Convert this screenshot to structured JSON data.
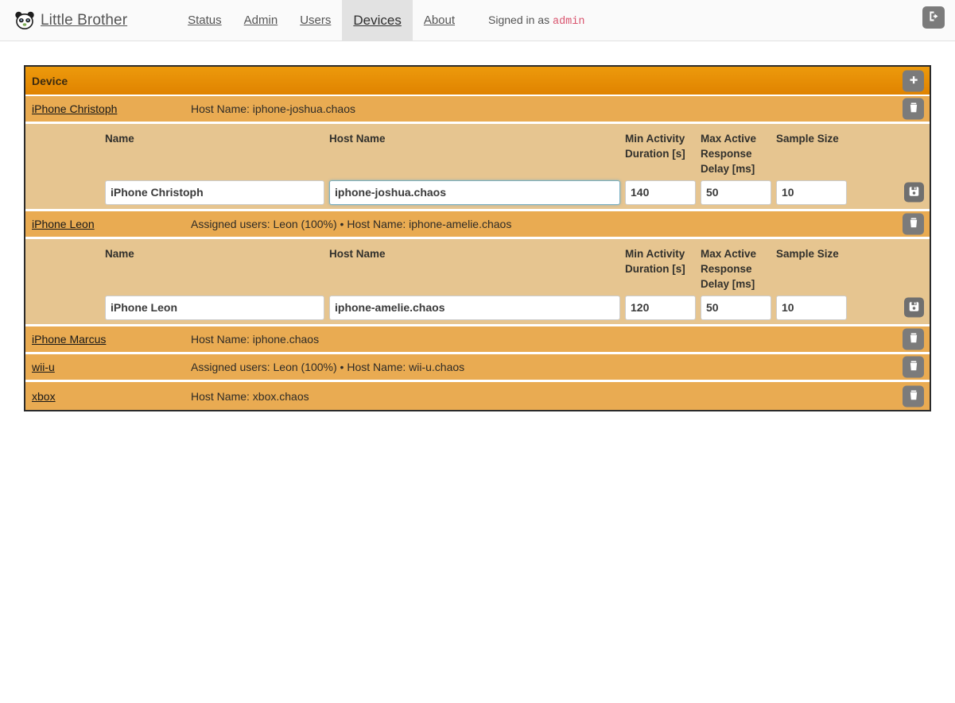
{
  "nav": {
    "brand": "Little Brother",
    "brand_icon": "panda-icon",
    "links": [
      {
        "label": "Status",
        "active": false
      },
      {
        "label": "Admin",
        "active": false
      },
      {
        "label": "Users",
        "active": false
      },
      {
        "label": "Devices",
        "active": true
      },
      {
        "label": "About",
        "active": false
      }
    ],
    "signed_in_label": "Signed in as",
    "signed_in_user": "admin",
    "logout_icon": "logout-icon"
  },
  "panel": {
    "header_title": "Device",
    "add_icon": "plus-icon",
    "delete_icon": "trash-icon",
    "save_icon": "save-icon",
    "columns": {
      "name": "Name",
      "host_name": "Host Name",
      "min_activity": "Min Activity Duration [s]",
      "max_active": "Max Active Response Delay [ms]",
      "sample_size": "Sample Size"
    },
    "devices": [
      {
        "name": "iPhone Christoph",
        "meta": "Host Name: iphone-joshua.chaos",
        "expanded": true,
        "form": {
          "name": "iPhone Christoph",
          "host_name": "iphone-joshua.chaos",
          "host_name_focused": true,
          "min_activity_duration": "140",
          "max_active_response_delay": "50",
          "sample_size": "10"
        }
      },
      {
        "name": "iPhone Leon",
        "meta": "Assigned users: Leon (100%) • Host Name: iphone-amelie.chaos",
        "expanded": true,
        "form": {
          "name": "iPhone Leon",
          "host_name": "iphone-amelie.chaos",
          "host_name_focused": false,
          "min_activity_duration": "120",
          "max_active_response_delay": "50",
          "sample_size": "10"
        }
      },
      {
        "name": "iPhone Marcus",
        "meta": "Host Name: iphone.chaos",
        "expanded": false
      },
      {
        "name": "wii-u",
        "meta": "Assigned users: Leon (100%) • Host Name: wii-u.chaos",
        "expanded": false
      },
      {
        "name": "xbox",
        "meta": "Host Name: xbox.chaos",
        "expanded": false
      }
    ]
  },
  "colors": {
    "header_orange": "#e08300",
    "row_orange": "#e9ab52",
    "edit_tan": "#e6c590",
    "accent_user": "#d9546e",
    "icon_gray": "#7b7b7b",
    "focus_blue": "#79b0c4"
  }
}
